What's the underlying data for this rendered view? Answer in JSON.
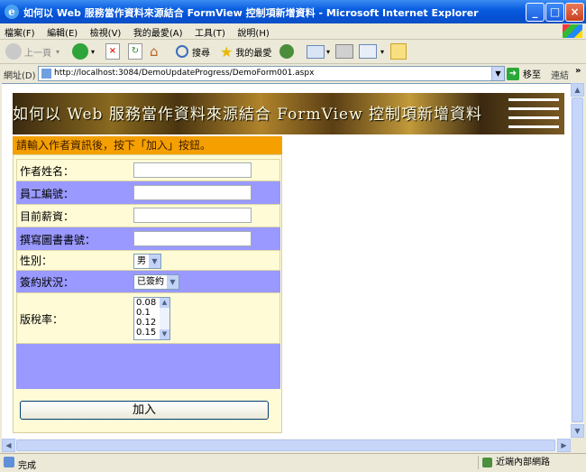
{
  "window": {
    "title": "如何以 Web 服務當作資料來源結合 FormView 控制項新增資料 - Microsoft Internet Explorer",
    "minimize": "_",
    "maximize": "□",
    "close": "×"
  },
  "menu": {
    "items": [
      "檔案(F)",
      "編輯(E)",
      "檢視(V)",
      "我的最愛(A)",
      "工具(T)",
      "說明(H)"
    ]
  },
  "toolbar": {
    "back": "上一頁",
    "search": "搜尋",
    "favorites": "我的最愛"
  },
  "address": {
    "label": "網址(D)",
    "url": "http://localhost:3084/DemoUpdateProgress/DemoForm001.aspx",
    "go": "移至",
    "links": "連結"
  },
  "page": {
    "banner_title": "如何以 Web 服務當作資料來源結合 FormView 控制項新增資料",
    "header": "請輸入作者資訊後，按下「加入」按鈕。",
    "fields": {
      "author_name": {
        "label": "作者姓名：",
        "value": ""
      },
      "employee_id": {
        "label": "員工編號：",
        "value": ""
      },
      "salary": {
        "label": "目前薪資：",
        "value": ""
      },
      "book_id": {
        "label": "撰寫圖書書號：",
        "value": ""
      },
      "gender": {
        "label": "性別：",
        "selected": "男"
      },
      "contract": {
        "label": "簽約狀況：",
        "selected": "已簽約"
      },
      "royalty": {
        "label": "版稅率：",
        "options": [
          "0.08",
          "0.1",
          "0.12",
          "0.15"
        ]
      }
    },
    "add_button": "加入"
  },
  "status": {
    "text": "完成",
    "zone": "近端內部網路"
  }
}
